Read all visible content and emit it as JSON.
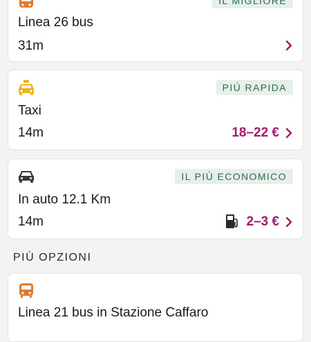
{
  "cards": [
    {
      "icon": "bus-icon",
      "badge": "IL MIGLIORE",
      "title": "Linea 26 bus",
      "duration": "31m",
      "price": ""
    },
    {
      "icon": "taxi-icon",
      "badge": "PIÚ RAPIDA",
      "title": "Taxi",
      "duration": "14m",
      "price": "18–22 €"
    },
    {
      "icon": "car-icon",
      "badge": "IL PIÙ ECONOMICO",
      "title": "In auto 12.1 Km",
      "duration": "14m",
      "price": "2–3 €",
      "extra_icon": "fuel-pump-icon"
    }
  ],
  "section": {
    "title": "PIÙ OPZIONI"
  },
  "more_options": [
    {
      "icon": "bus-icon",
      "title": "Linea 21 bus in Stazione Caffaro"
    }
  ],
  "colors": {
    "accent": "#a3176c",
    "badge_bg": "#e6efe9",
    "badge_text": "#2f6b48",
    "bus_icon": "#e07a2e",
    "taxi_icon": "#f0b21c",
    "car_icon": "#3a3a3a"
  }
}
